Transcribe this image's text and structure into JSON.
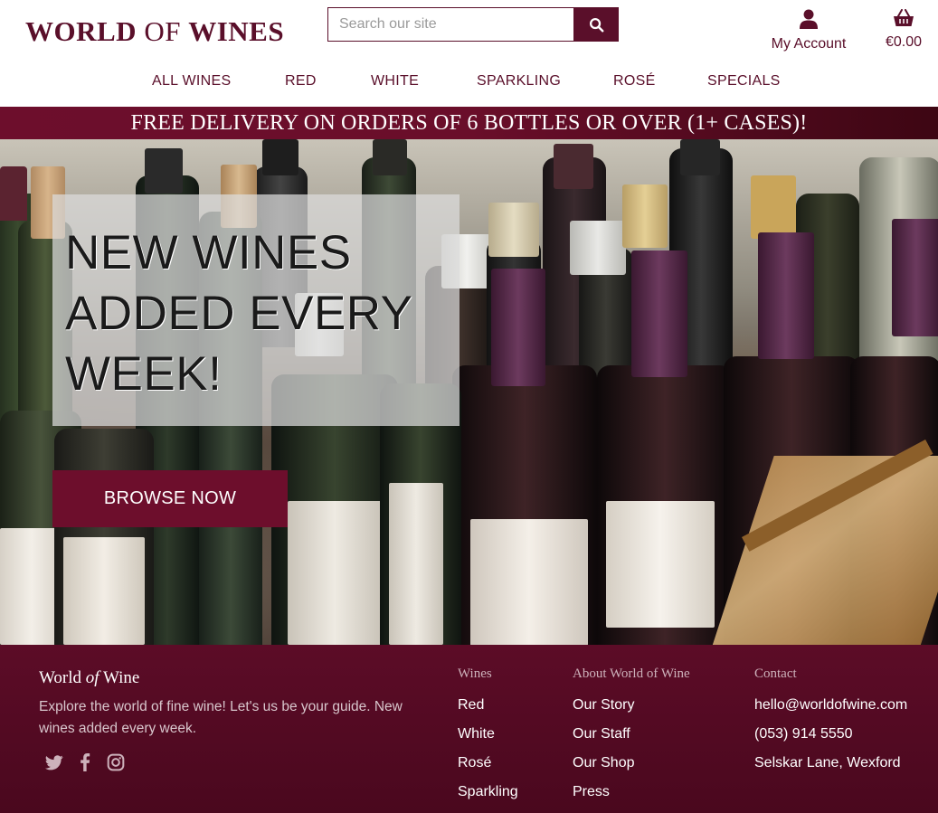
{
  "header": {
    "logo": {
      "part1": "WORLD",
      "part2": "OF",
      "part3": "WINES"
    },
    "search": {
      "placeholder": "Search our site",
      "button_icon": "search-icon"
    },
    "account": {
      "label": "My Account",
      "icon": "user-icon"
    },
    "cart": {
      "total": "€0.00",
      "icon": "basket-icon"
    },
    "nav": [
      {
        "label": "ALL WINES"
      },
      {
        "label": "RED"
      },
      {
        "label": "WHITE"
      },
      {
        "label": "SPARKLING"
      },
      {
        "label": "ROSÉ"
      },
      {
        "label": "SPECIALS"
      }
    ]
  },
  "banner": {
    "text": "FREE DELIVERY ON ORDERS OF 6 BOTTLES OR OVER (1+ CASES)!"
  },
  "hero": {
    "headline": "NEW WINES ADDED EVERY WEEK!",
    "cta": "BROWSE NOW",
    "image": "wine-bottles-photo"
  },
  "footer": {
    "brand": {
      "part1": "World ",
      "part2": "of",
      "part3": " Wine"
    },
    "tagline": "Explore the world of fine wine! Let's us be your guide. New wines added every week.",
    "social": [
      "twitter-icon",
      "facebook-icon",
      "instagram-icon"
    ],
    "wines": {
      "title": "Wines",
      "items": [
        "Red",
        "White",
        "Rosé",
        "Sparkling"
      ]
    },
    "about": {
      "title": "About World of Wine",
      "items": [
        "Our Story",
        "Our Staff",
        "Our Shop",
        "Press"
      ]
    },
    "contact": {
      "title": "Contact",
      "items": [
        "hello@worldofwine.com",
        "(053) 914 5550",
        "Selskar Lane, Wexford"
      ]
    }
  },
  "colors": {
    "brand": "#5a0f2a",
    "banner": "#6d0e2c",
    "footer": "#5c0c27"
  }
}
